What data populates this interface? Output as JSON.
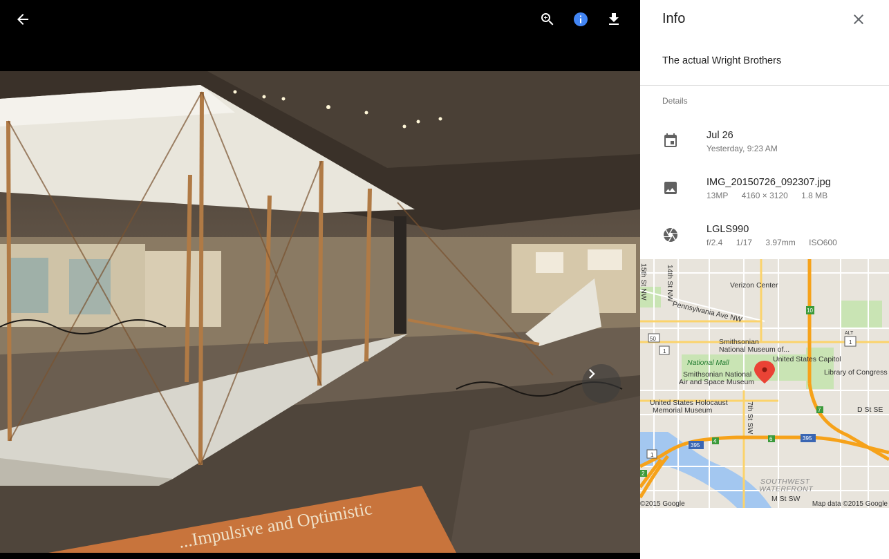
{
  "toolbar": {
    "back": "back-arrow-icon",
    "zoom": "zoom-in-icon",
    "info": "info-icon",
    "download": "download-icon"
  },
  "viewer": {
    "next": "chevron-right-icon",
    "sign_text": "...Impulsive and Optimistic"
  },
  "panel": {
    "title": "Info",
    "description": "The actual Wright Brothers",
    "details_heading": "Details",
    "date": {
      "primary": "Jul 26",
      "secondary": "Yesterday, 9:23 AM"
    },
    "file": {
      "primary": "IMG_20150726_092307.jpg",
      "megapixels": "13MP",
      "resolution": "4160 × 3120",
      "size": "1.8 MB"
    },
    "camera": {
      "primary": "LGLS990",
      "aperture": "f/2.4",
      "shutter": "1/17",
      "focal": "3.97mm",
      "iso": "ISO600"
    }
  },
  "map": {
    "labels": {
      "fifteenth": "15th St NW",
      "fourteenth": "14th St NW",
      "verizon": "Verizon Center",
      "penn": "Pennsylvania Ave NW",
      "smithsonian_nm": "Smithsonian",
      "smithsonian_nm2": "National Museum of...",
      "mall": "National Mall",
      "air_space1": "Smithsonian National",
      "air_space2": "Air and Space Museum",
      "capitol": "United States Capitol",
      "library": "Library of Congress",
      "holocaust1": "United States Holocaust",
      "holocaust2": "Memorial Museum",
      "dst": "D St SE",
      "seventh": "7th St SW",
      "southwest1": "SOUTHWEST",
      "southwest2": "WATERFRONT",
      "mst": "M St SW",
      "r50": "50",
      "r1a": "1",
      "r1b": "1",
      "r1c": "1",
      "r395a": "395",
      "r395b": "395",
      "r10": "10",
      "r4": "4",
      "r6": "6",
      "r7": "7",
      "r2": "2",
      "alt": "ALT"
    },
    "copyright": "©2015 Google",
    "data_credit": "Map data ©2015 Google"
  },
  "colors": {
    "info_accent": "#4285f4",
    "pin": "#ea4335",
    "highway": "#f6a21a",
    "arterial": "#fbd36b",
    "water": "#a3c7f0",
    "park": "#c9e4b4"
  }
}
